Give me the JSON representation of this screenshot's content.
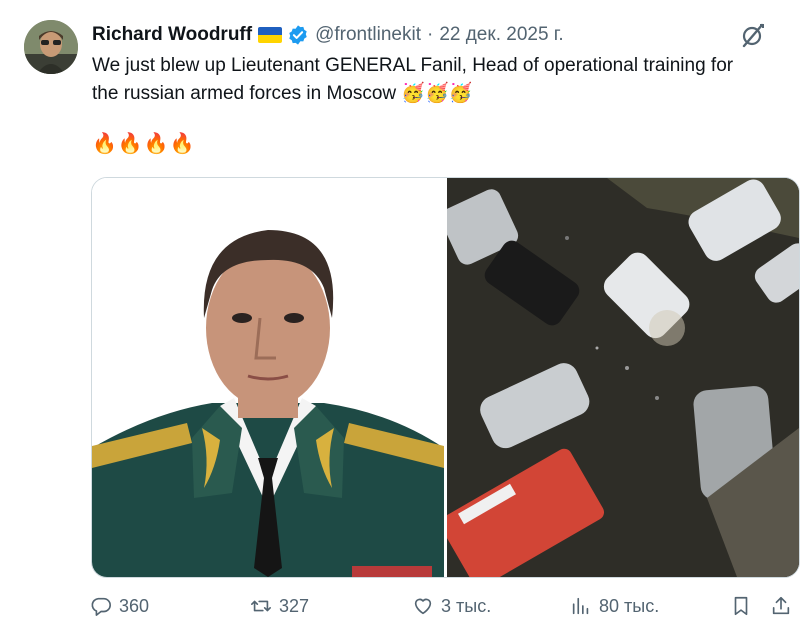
{
  "author": {
    "name": "Richard Woodruff",
    "handle": "@frontlinekit",
    "date": "22 дек. 2025 г.",
    "separator": "·",
    "flag_colors": [
      "#1f5fbf",
      "#ffd400"
    ],
    "verified_color": "#1d9bf0"
  },
  "tweet": {
    "line1": "We just blew up Lieutenant GENERAL Fanil, Head of operational training for",
    "line2": "the russian armed forces in Moscow",
    "line2_emojis": "🥳🥳🥳",
    "fires": "🔥🔥🔥🔥"
  },
  "actions": {
    "replies": "360",
    "retweets": "327",
    "likes": "3 тыс.",
    "views": "80 тыс."
  },
  "colors": {
    "text": "#0f1419",
    "secondary": "#536471",
    "border": "#cfd9de"
  },
  "icons": {
    "reply": "reply-icon",
    "retweet": "retweet-icon",
    "like": "heart-icon",
    "views": "views-icon",
    "bookmark": "bookmark-icon",
    "share": "share-icon",
    "grok": "grok-icon"
  }
}
